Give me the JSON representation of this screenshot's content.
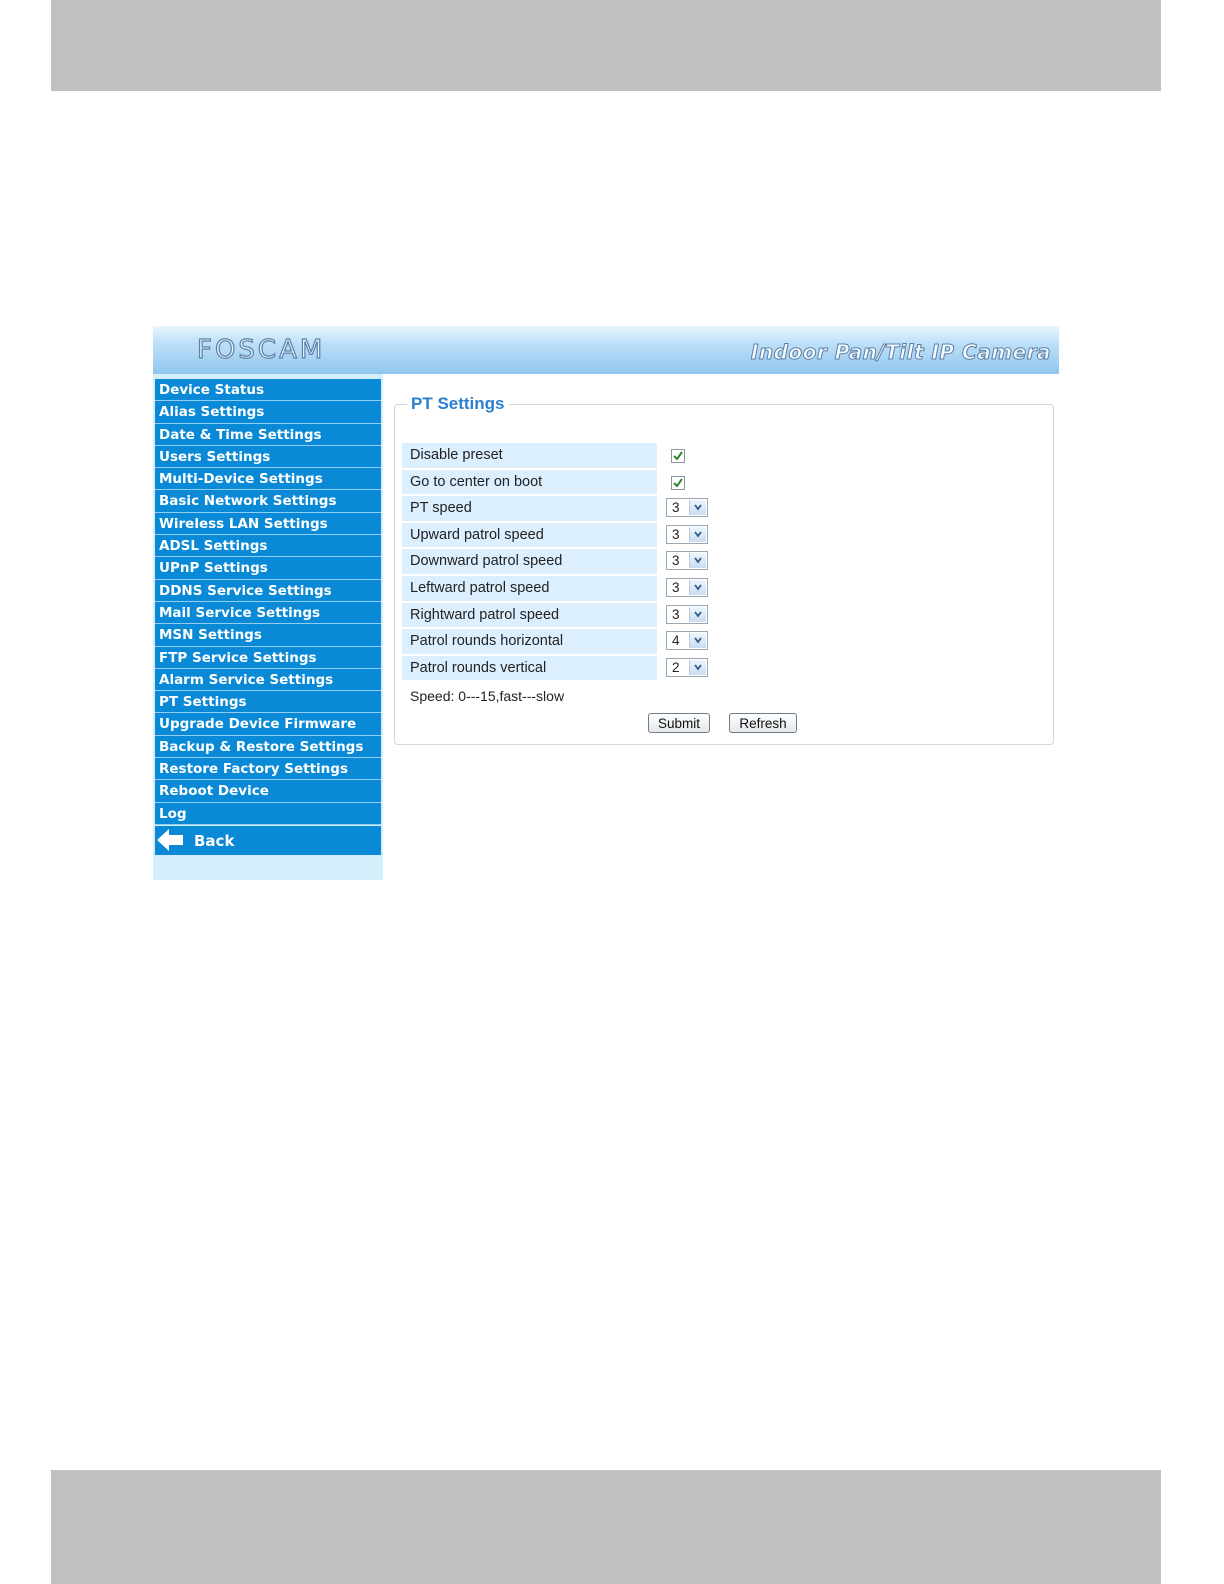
{
  "banner": {
    "logo": "FOSCAM",
    "product": "Indoor Pan/Tilt IP Camera"
  },
  "sidebar": {
    "items": [
      "Device Status",
      "Alias Settings",
      "Date & Time Settings",
      "Users Settings",
      "Multi-Device Settings",
      "Basic Network Settings",
      "Wireless LAN Settings",
      "ADSL Settings",
      "UPnP Settings",
      "DDNS Service Settings",
      "Mail Service Settings",
      "MSN Settings",
      "FTP Service Settings",
      "Alarm Service Settings",
      "PT Settings",
      "Upgrade Device Firmware",
      "Backup & Restore Settings",
      "Restore Factory Settings",
      "Reboot Device",
      "Log"
    ],
    "back_label": "Back"
  },
  "panel": {
    "title": "PT Settings",
    "rows": [
      {
        "label": "Disable preset",
        "type": "checkbox",
        "checked": true
      },
      {
        "label": "Go to center on boot",
        "type": "checkbox",
        "checked": true
      },
      {
        "label": "PT speed",
        "type": "select",
        "value": "3"
      },
      {
        "label": "Upward patrol speed",
        "type": "select",
        "value": "3"
      },
      {
        "label": "Downward patrol speed",
        "type": "select",
        "value": "3"
      },
      {
        "label": "Leftward patrol speed",
        "type": "select",
        "value": "3"
      },
      {
        "label": "Rightward patrol speed",
        "type": "select",
        "value": "3"
      },
      {
        "label": "Patrol rounds horizontal",
        "type": "select",
        "value": "4"
      },
      {
        "label": "Patrol rounds vertical",
        "type": "select",
        "value": "2"
      }
    ],
    "note": "Speed: 0---15,fast---slow",
    "submit_label": "Submit",
    "refresh_label": "Refresh"
  },
  "colors": {
    "menu_bg": "#0a8ad6",
    "title": "#2b7fcf",
    "label_bg": "#dcefff"
  }
}
